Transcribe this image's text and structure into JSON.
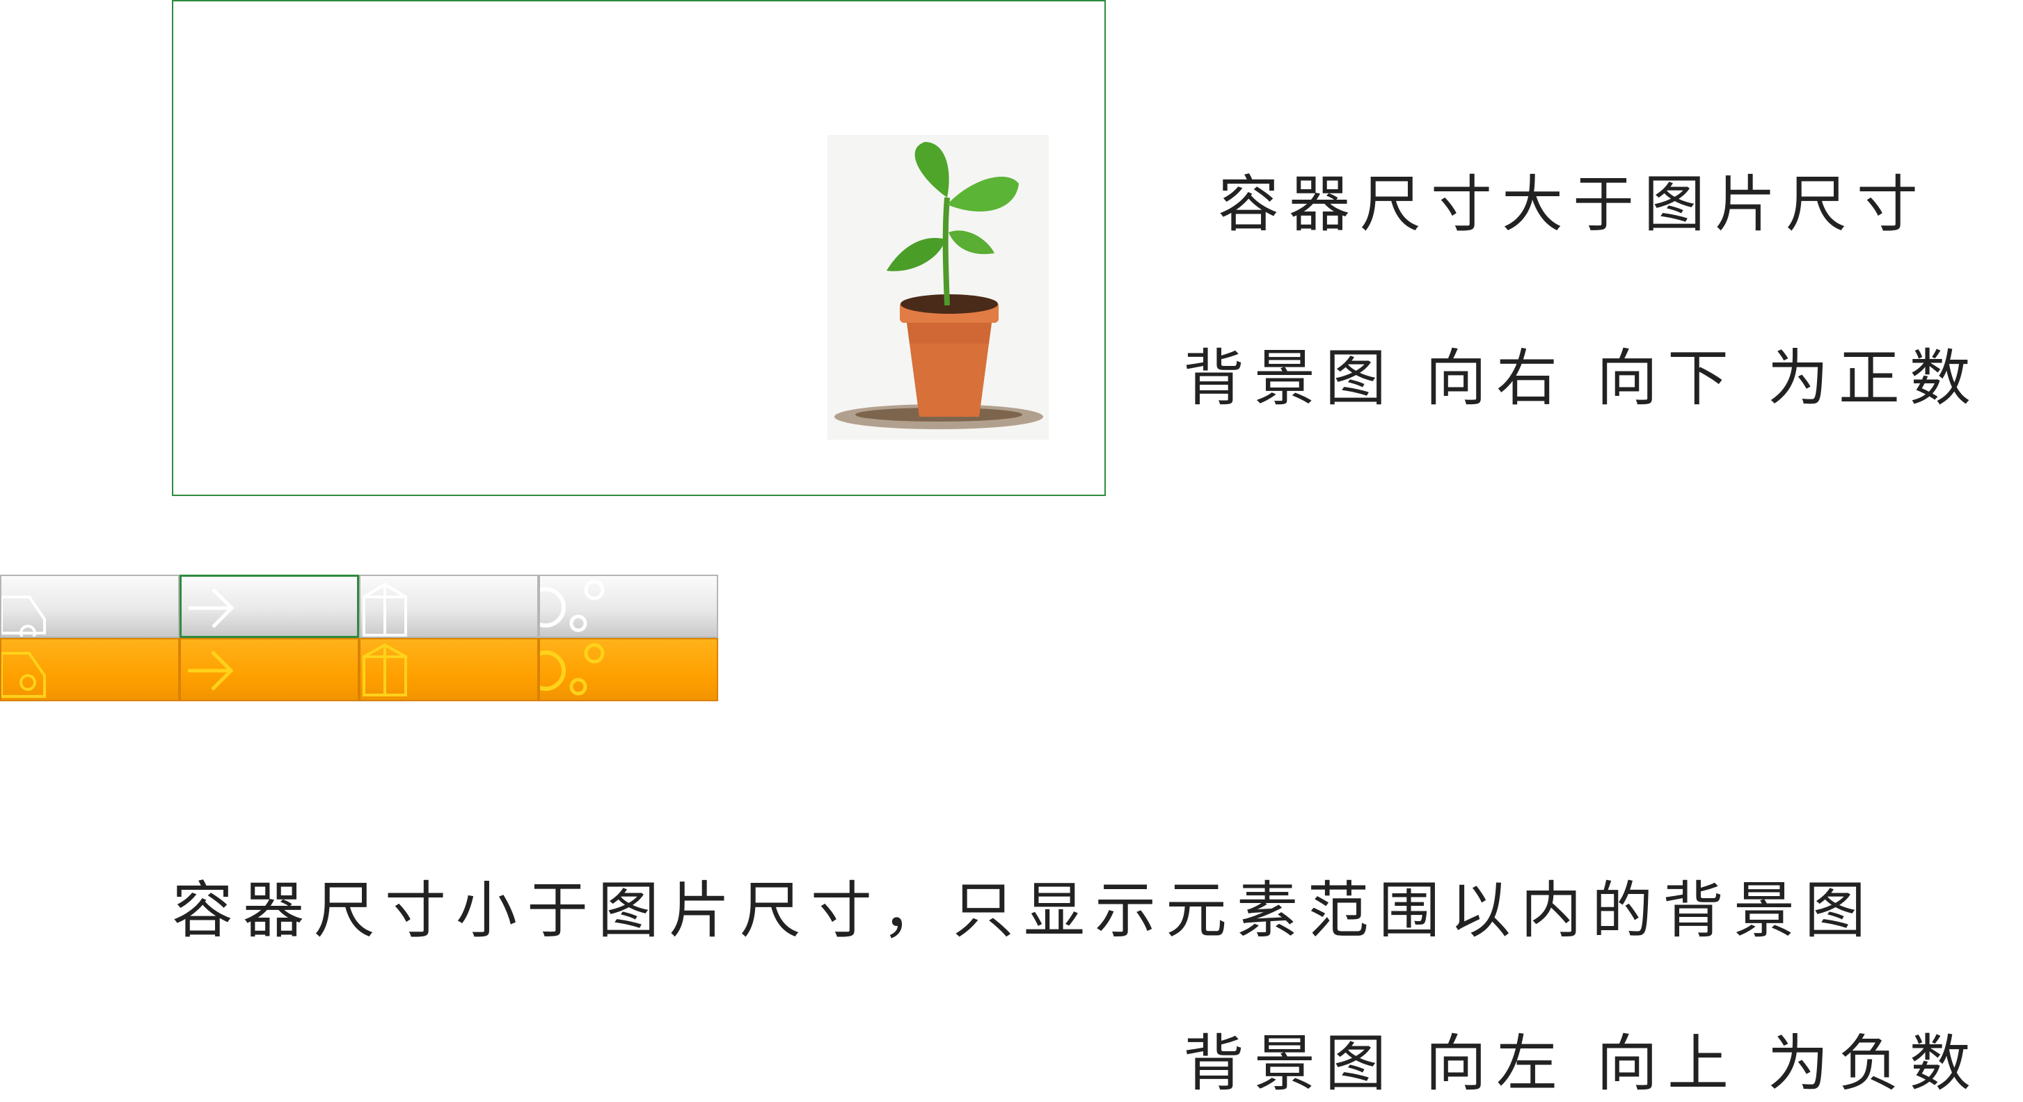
{
  "captions": {
    "larger_container": "容器尺寸大于图片尺寸",
    "positive_direction": "背景图 向右 向下 为正数",
    "smaller_container": "容器尺寸小于图片尺寸，只显示元素范围以内的背景图",
    "negative_direction": "背景图 向左 向上 为负数"
  },
  "icons": {
    "plant": "potted-plant-icon",
    "row_icons": [
      "car-icon",
      "arrow-right-icon",
      "gift-icon",
      "bubbles-icon"
    ]
  },
  "colors": {
    "container_border": "#2e8b3e",
    "gray_button": "#e6e6e6",
    "orange_button": "#ffa000",
    "icon_gray": "#ffffff",
    "icon_orange": "#ffd21a"
  }
}
